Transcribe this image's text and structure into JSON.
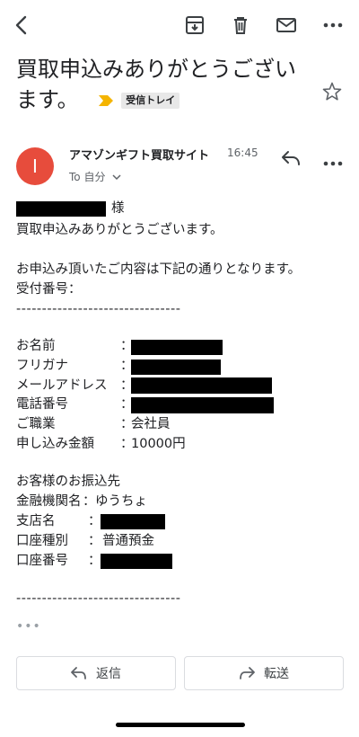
{
  "toolbar": {
    "back_icon": "back-arrow-icon",
    "archive_icon": "archive-icon",
    "delete_icon": "trash-icon",
    "mark_unread_icon": "mail-icon",
    "more_icon": "more-horizontal-icon"
  },
  "email": {
    "subject": "買取申込みありがとうございます。",
    "label": "受信トレイ",
    "label_color": "#f4b400",
    "sender_initial": "I",
    "sender_name": "アマゾンギフト買取サイト",
    "time": "16:45",
    "to_line": "To 自分",
    "avatar_color": "#e74c3c"
  },
  "body": {
    "honorific": "様",
    "thanks": "買取申込みありがとうございます。",
    "intro": "お申込み頂いたご内容は下記の通りとなります。",
    "receipt_label": "受付番号：",
    "separator": "--------------------------------",
    "fields": [
      {
        "label": "お名前",
        "colon": "：",
        "value": ""
      },
      {
        "label": "フリガナ",
        "colon": "：",
        "value": ""
      },
      {
        "label": "メールアドレス",
        "colon": "：",
        "value": ""
      },
      {
        "label": "電話番号",
        "colon": "：",
        "value": ""
      },
      {
        "label": "ご職業",
        "colon": "：",
        "value": "会社員"
      },
      {
        "label": "申し込み金額",
        "colon": "：",
        "value": "10000円"
      }
    ],
    "bank_heading": "お客様のお振込先",
    "bank": [
      {
        "label": "金融機関名",
        "colon": "：",
        "value": "ゆうちょ"
      },
      {
        "label": "支店名",
        "colon": "：",
        "value": ""
      },
      {
        "label": "口座種別",
        "colon": "：",
        "value": "普通預金"
      },
      {
        "label": "口座番号",
        "colon": "：",
        "value": ""
      }
    ],
    "separator_end": "--------------------------------",
    "trimmed": "•••"
  },
  "actions": {
    "reply_label": "返信",
    "forward_label": "転送"
  }
}
